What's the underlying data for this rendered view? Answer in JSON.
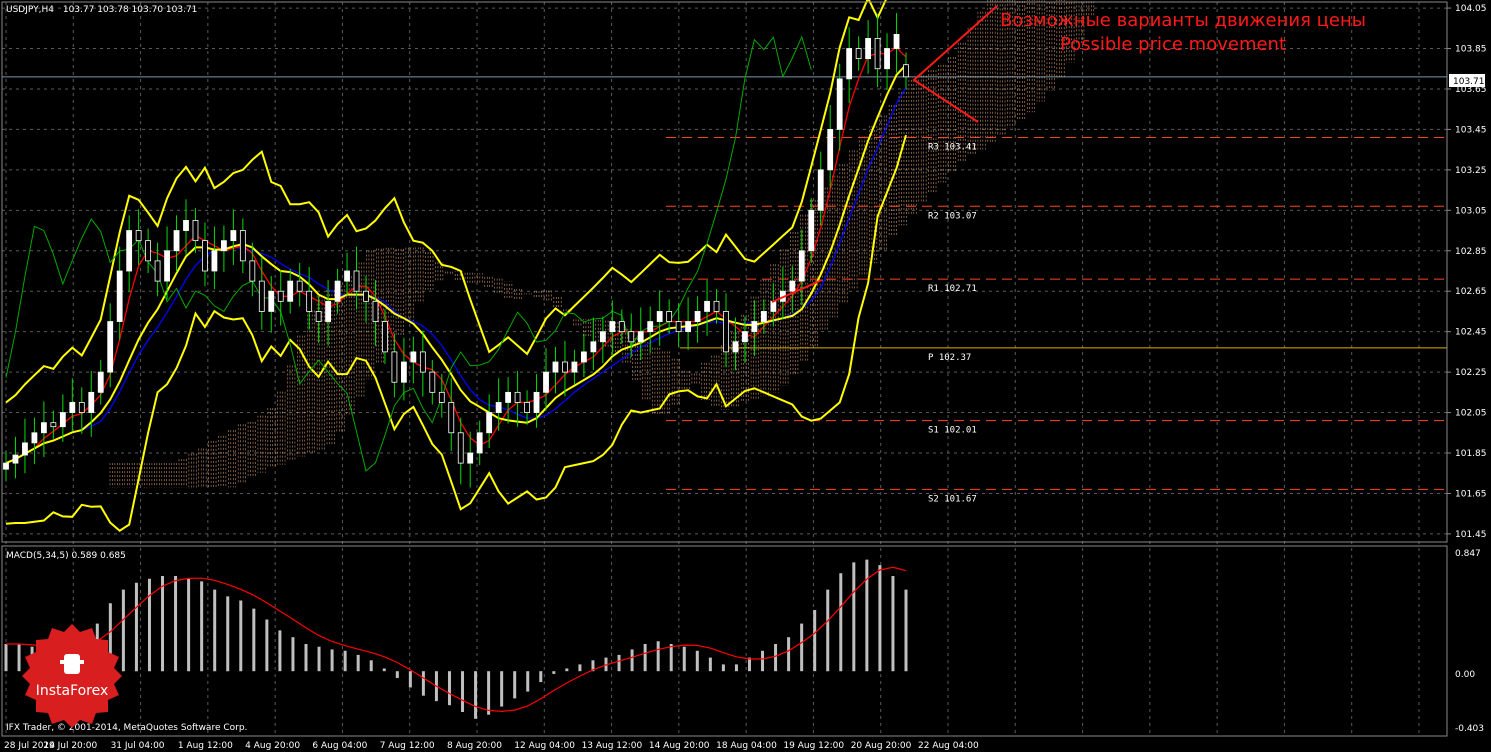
{
  "window": {
    "title": "USDJPY,H4",
    "ohlc": "103.77 103.78 103.70 103.71",
    "last_price": "103.71"
  },
  "annotation": {
    "ru": "Возможные варианты движения цены",
    "en": "Possible price movement"
  },
  "macd": {
    "header": "MACD(5,34,5) 0.589 0.685",
    "axis": [
      "0.847",
      "0.00",
      "-0.403"
    ]
  },
  "footer": {
    "copyright": "IFX Trader, © 2001-2014, MetaQuotes Software Corp."
  },
  "logo": {
    "text": "InstaForex"
  },
  "colors": {
    "background": "#000000",
    "grid": "#5a5a5a",
    "bull_candle": "#ffffff",
    "bear_candle": "#ffffff",
    "bollinger": "#ffff00",
    "tenkan": "#ff0000",
    "kijun": "#0000ff",
    "chikou": "#00aa00",
    "cloud": "#ffbb88",
    "pivot": "#ff4422",
    "annotation": "#ff1a1a",
    "macd_hist": "#c0c0c0",
    "macd_signal": "#ff0000"
  },
  "chart_data": {
    "type": "candlestick",
    "symbol": "USDJPY",
    "timeframe": "H4",
    "ylim": [
      101.41,
      104.08
    ],
    "y_ticks": [
      104.05,
      103.85,
      103.65,
      103.45,
      103.25,
      103.05,
      102.85,
      102.65,
      102.45,
      102.25,
      102.05,
      101.85,
      101.65,
      101.45
    ],
    "x_ticks": [
      "28 Jul 2014",
      "29 Jul 20:00",
      "31 Jul 04:00",
      "1 Aug 12:00",
      "4 Aug 20:00",
      "6 Aug 04:00",
      "7 Aug 12:00",
      "8 Aug 20:00",
      "12 Aug 04:00",
      "13 Aug 12:00",
      "14 Aug 20:00",
      "18 Aug 04:00",
      "19 Aug 12:00",
      "20 Aug 20:00",
      "22 Aug 04:00"
    ],
    "pivot_levels": [
      {
        "name": "R3",
        "label": "R3 103.41",
        "value": 103.41
      },
      {
        "name": "R2",
        "label": "R2 103.07",
        "value": 103.07
      },
      {
        "name": "R1",
        "label": "R1 102.71",
        "value": 102.71
      },
      {
        "name": "P",
        "label": "P 102.37",
        "value": 102.37
      },
      {
        "name": "S1",
        "label": "S1 102.01",
        "value": 102.01
      },
      {
        "name": "S2",
        "label": "S2 101.67",
        "value": 101.67
      }
    ],
    "close": [
      101.8,
      101.84,
      101.9,
      101.95,
      102.0,
      101.98,
      102.05,
      102.1,
      102.05,
      102.15,
      102.25,
      102.5,
      102.75,
      102.95,
      102.9,
      102.8,
      102.7,
      102.85,
      102.95,
      103.0,
      102.9,
      102.75,
      102.85,
      102.9,
      102.95,
      102.8,
      102.7,
      102.55,
      102.65,
      102.6,
      102.7,
      102.65,
      102.55,
      102.5,
      102.6,
      102.7,
      102.75,
      102.65,
      102.6,
      102.5,
      102.35,
      102.2,
      102.3,
      102.35,
      102.25,
      102.15,
      102.1,
      101.95,
      101.8,
      101.85,
      101.95,
      102.05,
      102.1,
      102.15,
      102.1,
      102.05,
      102.15,
      102.25,
      102.3,
      102.25,
      102.3,
      102.35,
      102.4,
      102.45,
      102.5,
      102.45,
      102.4,
      102.45,
      102.5,
      102.55,
      102.5,
      102.45,
      102.5,
      102.55,
      102.6,
      102.55,
      102.35,
      102.4,
      102.45,
      102.5,
      102.55,
      102.6,
      102.65,
      102.7,
      102.85,
      103.05,
      103.25,
      103.45,
      103.7,
      103.85,
      103.8,
      103.9,
      103.75,
      103.85,
      103.92,
      103.71
    ],
    "open": [
      101.77,
      101.8,
      101.84,
      101.9,
      101.95,
      102.0,
      101.98,
      102.05,
      102.1,
      102.05,
      102.15,
      102.25,
      102.5,
      102.75,
      102.95,
      102.9,
      102.8,
      102.7,
      102.85,
      102.95,
      103.0,
      102.9,
      102.75,
      102.85,
      102.9,
      102.95,
      102.8,
      102.7,
      102.55,
      102.65,
      102.6,
      102.7,
      102.65,
      102.55,
      102.5,
      102.6,
      102.7,
      102.75,
      102.65,
      102.6,
      102.5,
      102.35,
      102.2,
      102.3,
      102.35,
      102.25,
      102.15,
      102.1,
      101.95,
      101.8,
      101.85,
      101.95,
      102.05,
      102.1,
      102.15,
      102.1,
      102.05,
      102.15,
      102.25,
      102.3,
      102.25,
      102.3,
      102.35,
      102.4,
      102.45,
      102.5,
      102.45,
      102.4,
      102.45,
      102.5,
      102.55,
      102.5,
      102.45,
      102.5,
      102.55,
      102.6,
      102.55,
      102.35,
      102.4,
      102.45,
      102.5,
      102.55,
      102.6,
      102.65,
      102.7,
      102.85,
      103.05,
      103.25,
      103.45,
      103.7,
      103.85,
      103.8,
      103.9,
      103.75,
      103.85,
      103.77
    ],
    "bollinger_upper": [
      102.0,
      102.0,
      102.0,
      102.0,
      102.02,
      102.05,
      102.1,
      102.2,
      102.35,
      102.6,
      102.85,
      103.05,
      103.2,
      103.28,
      103.28,
      103.25,
      103.2,
      103.12,
      103.02,
      103.0,
      102.98,
      102.96,
      102.94,
      102.92,
      102.9,
      102.88,
      102.87,
      102.87,
      102.87,
      102.9,
      102.85,
      102.75,
      102.6,
      102.5,
      102.45,
      102.43,
      102.42,
      102.42,
      102.45,
      102.5,
      102.52,
      102.55,
      102.56,
      102.57,
      102.58,
      102.6,
      102.62,
      102.64,
      102.66,
      102.68,
      102.7,
      102.72,
      102.74,
      102.76,
      102.8,
      103.0,
      103.3,
      103.6,
      104.0,
      104.2
    ],
    "macd_hist": [
      0.2,
      0.2,
      0.18,
      0.16,
      0.15,
      0.2,
      0.25,
      0.35,
      0.5,
      0.6,
      0.65,
      0.68,
      0.7,
      0.7,
      0.68,
      0.66,
      0.6,
      0.55,
      0.52,
      0.46,
      0.38,
      0.3,
      0.25,
      0.2,
      0.18,
      0.16,
      0.15,
      0.12,
      0.08,
      0.02,
      -0.05,
      -0.12,
      -0.18,
      -0.22,
      -0.25,
      -0.3,
      -0.35,
      -0.32,
      -0.26,
      -0.2,
      -0.15,
      -0.08,
      -0.02,
      0.02,
      0.05,
      0.08,
      0.1,
      0.12,
      0.16,
      0.2,
      0.22,
      0.2,
      0.18,
      0.15,
      0.1,
      0.05,
      0.05,
      0.1,
      0.15,
      0.2,
      0.25,
      0.35,
      0.45,
      0.6,
      0.72,
      0.8,
      0.82,
      0.78,
      0.7,
      0.6
    ]
  }
}
